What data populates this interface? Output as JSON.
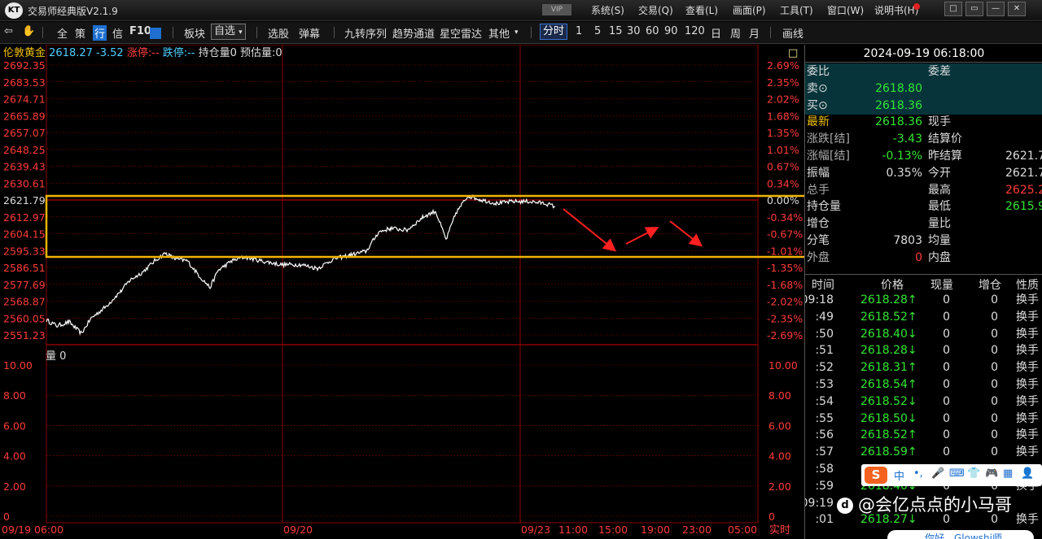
{
  "titlebar": {
    "logo": "KT",
    "app_title": "交易师经典版V2.1.9",
    "vip": "VIP",
    "menu": [
      "系统(S)",
      "交易(Q)",
      "查看(L)",
      "画面(P)",
      "工具(T)",
      "窗口(W)",
      "说明书(H)"
    ],
    "controls": [
      "□",
      "▭",
      "—",
      "✕"
    ]
  },
  "toolbar": {
    "back_icon": "⇦",
    "hand_icon": "✋",
    "items": [
      "全",
      "策",
      "行",
      "信",
      "F10",
      "板块",
      "自选",
      "选股",
      "弹幕",
      "九转序列",
      "趋势通道",
      "星空雷达",
      "其他",
      "分时",
      "1",
      "5",
      "15",
      "30",
      "60",
      "90",
      "120",
      "日",
      "周",
      "月",
      "画线"
    ],
    "dropdown_arrow": "▾"
  },
  "chart": {
    "instrument": "伦敦黄金",
    "last": "2618.27",
    "change": "-3.52",
    "limit_up": "涨停:--",
    "limit_down": "跌停:--",
    "open_interest": "持仓量0",
    "est_volume": "预估量:0",
    "price_axis": [
      "2692.35",
      "2683.53",
      "2674.71",
      "2665.89",
      "2657.07",
      "2648.25",
      "2639.43",
      "2630.61",
      "2621.79",
      "2612.97",
      "2604.15",
      "2595.33",
      "2586.51",
      "2577.69",
      "2568.87",
      "2560.05",
      "2551.23"
    ],
    "pct_axis": [
      "2.69%",
      "2.35%",
      "2.02%",
      "1.68%",
      "1.35%",
      "1.01%",
      "0.67%",
      "0.34%",
      "0.00%",
      "-0.34%",
      "-0.67%",
      "-1.01%",
      "-1.35%",
      "-1.68%",
      "-2.02%",
      "-2.35%",
      "-2.69%"
    ],
    "volume_label": "量",
    "volume_value": "0",
    "volume_axis": [
      "10.00",
      "8.00",
      "6.00",
      "4.00",
      "2.00",
      "0"
    ],
    "time_axis": [
      "09/19 06:00",
      "09/20",
      "09/23",
      "11:00",
      "15:00",
      "19:00",
      "23:00",
      "05:00"
    ],
    "realtime_label": "实时",
    "corner_box": "□",
    "colors": {
      "up": "#ff3b3b",
      "down": "#33e633",
      "price_line": "#ffffff",
      "highlight_box": "#f0b400",
      "arrow": "#ff2020",
      "grid": "#8a0000"
    }
  },
  "quote": {
    "datetime": "2024-09-19 06:18:00",
    "rows": [
      {
        "l1": "委比",
        "v1": "",
        "l2": "委差",
        "v2": ""
      },
      {
        "l1": "卖⊙",
        "v1": "2618.80",
        "l2": "",
        "v2": ""
      },
      {
        "l1": "买⊙",
        "v1": "2618.36",
        "l2": "",
        "v2": ""
      },
      {
        "l1": "最新",
        "v1": "2618.36",
        "l2": "现手",
        "v2": ""
      },
      {
        "l1": "涨跌[结]",
        "v1": "-3.43",
        "l2": "结算价",
        "v2": ""
      },
      {
        "l1": "涨幅[结]",
        "v1": "-0.13%",
        "l2": "昨结算",
        "v2": "2621.7"
      },
      {
        "l1": "振幅",
        "v1": "0.35%",
        "l2": "今开",
        "v2": "2621.7"
      },
      {
        "l1": "总手",
        "v1": "",
        "l2": "最高",
        "v2": "2625.2"
      },
      {
        "l1": "持仓量",
        "v1": "",
        "l2": "最低",
        "v2": "2615.9"
      },
      {
        "l1": "增仓",
        "v1": "",
        "l2": "量比",
        "v2": ""
      },
      {
        "l1": "分笔",
        "v1": "7803",
        "l2": "均量",
        "v2": ""
      },
      {
        "l1": "外盘",
        "v1": "0",
        "l2": "内盘",
        "v2": ""
      }
    ]
  },
  "trades": {
    "headers": [
      "时间",
      "价格",
      "现量",
      "增仓",
      "性质"
    ],
    "rows": [
      {
        "t": "09:18",
        "p": "2618.28↑",
        "q": "0",
        "z": "0",
        "x": "换手"
      },
      {
        "t": ":49",
        "p": "2618.52↑",
        "q": "0",
        "z": "0",
        "x": "换手"
      },
      {
        "t": ":50",
        "p": "2618.40↓",
        "q": "0",
        "z": "0",
        "x": "换手"
      },
      {
        "t": ":51",
        "p": "2618.28↓",
        "q": "0",
        "z": "0",
        "x": "换手"
      },
      {
        "t": ":52",
        "p": "2618.31↑",
        "q": "0",
        "z": "0",
        "x": "换手"
      },
      {
        "t": ":53",
        "p": "2618.54↑",
        "q": "0",
        "z": "0",
        "x": "换手"
      },
      {
        "t": ":54",
        "p": "2618.52↓",
        "q": "0",
        "z": "0",
        "x": "换手"
      },
      {
        "t": ":55",
        "p": "2618.50↓",
        "q": "0",
        "z": "0",
        "x": "换手"
      },
      {
        "t": ":56",
        "p": "2618.52↑",
        "q": "0",
        "z": "0",
        "x": "换手"
      },
      {
        "t": ":57",
        "p": "2618.59↑",
        "q": "0",
        "z": "0",
        "x": "换手"
      },
      {
        "t": ":58",
        "p": "",
        "q": "",
        "z": "",
        "x": ""
      },
      {
        "t": ":59",
        "p": "2618.40↓",
        "q": "0",
        "z": "0",
        "x": "换手"
      },
      {
        "t": "09:19",
        "p": "",
        "q": "",
        "z": "",
        "x": ""
      },
      {
        "t": ":01",
        "p": "2618.27↓",
        "q": "0",
        "z": "0",
        "x": "换手"
      }
    ]
  },
  "overlay": {
    "ime": [
      "S",
      "中",
      "•,",
      "🎤",
      "⌨",
      "👕",
      "🎮",
      "▦",
      "👤"
    ],
    "watermark": "@会亿点点的小马哥",
    "watermark_icon": "d",
    "greeting": "你好，Glowshi师"
  }
}
